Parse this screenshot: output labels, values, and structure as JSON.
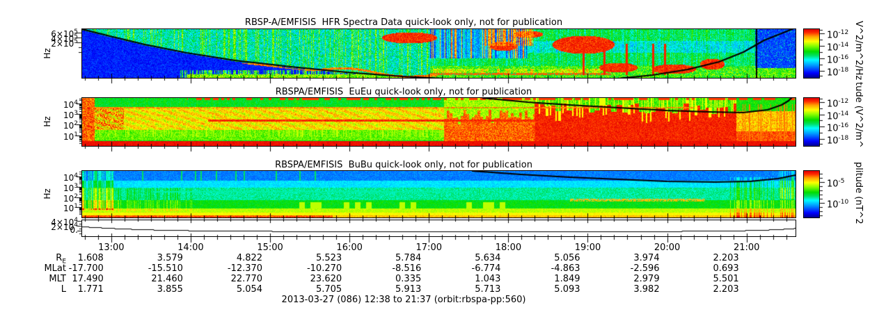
{
  "figure": {
    "bg": "#ffffff",
    "text_color": "#000000"
  },
  "chart_data": {
    "type": "heatmap",
    "subtype": "spectrogram-stack",
    "time_range": {
      "start": "12:38",
      "end": "21:37",
      "date": "2013-03-27",
      "doy": "086"
    },
    "x_ticks": {
      "major_labels": [
        "13:00",
        "14:00",
        "15:00",
        "16:00",
        "17:00",
        "18:00",
        "19:00",
        "20:00",
        "21:00"
      ],
      "major_fracs": [
        0.0408,
        0.1521,
        0.2635,
        0.3748,
        0.4861,
        0.5975,
        0.7088,
        0.8201,
        0.9314
      ],
      "minor_step_minutes": 10,
      "total_minutes": 539
    },
    "panels": [
      {
        "id": "hfr",
        "title": "RBSP-A/EMFISIS  HFR Spectra Data quick-look only, not for publication",
        "ylabel": "Hz",
        "ytick_labels": [
          "6×10^5",
          "4×10^5",
          "2×10^5"
        ],
        "ytick_rel": [
          5,
          12,
          19
        ],
        "overlay": "fce black curve, dips below panel mid-orbit",
        "colormap": "rainbow",
        "colorbar": {
          "unit": "V^2/m^2/Hz",
          "tick_labels": [
            "10^-12",
            "10^-14",
            "10^-16",
            "10^-18"
          ],
          "tick_fracs": [
            0.086,
            0.343,
            0.6,
            0.857
          ]
        }
      },
      {
        "id": "euEu",
        "title": "RBSPA/EMFISIS  EuEu quick-look only, not for publication",
        "ylabel": "Hz",
        "ytick_labels": [
          "10^4",
          "10^3",
          "10^2",
          "10^1"
        ],
        "ytick_rel": [
          8,
          23,
          38,
          54
        ],
        "overlay": "fce black curve near top, enters at ~55% width",
        "colormap": "rainbow",
        "colorbar": {
          "unit": "tude (V^2/m^",
          "tick_labels": [
            "10^-12",
            "10^-14",
            "10^-16",
            "10^-18"
          ],
          "tick_fracs": [
            0.086,
            0.343,
            0.6,
            0.857
          ]
        }
      },
      {
        "id": "buBu",
        "title": "RBSPA/EMFISIS  BuBu quick-look only, not for publication",
        "ylabel": "Hz",
        "ytick_labels": [
          "10^4",
          "10^3",
          "10^2",
          "10^1"
        ],
        "ytick_rel": [
          8,
          23,
          38,
          52
        ],
        "overlay": "fce black curve near top, enters at ~55% width",
        "colormap": "rainbow",
        "colorbar": {
          "unit": "plitude (nT^2",
          "tick_labels": [
            "10^-5",
            "10^-10"
          ],
          "tick_fracs": [
            0.24,
            0.69
          ]
        }
      }
    ],
    "aux_panel": {
      "type": "line",
      "ytick_labels": [
        "4×10^4",
        "2×10^4",
        "0."
      ],
      "ytick_rel": [
        1,
        8,
        15
      ],
      "series_points_frac": [
        [
          0,
          0.39
        ],
        [
          0.02,
          0.44
        ],
        [
          0.045,
          0.5
        ],
        [
          0.075,
          0.555
        ],
        [
          0.11,
          0.6
        ],
        [
          0.155,
          0.635
        ],
        [
          0.21,
          0.66
        ],
        [
          0.27,
          0.675
        ],
        [
          0.35,
          0.685
        ],
        [
          0.5,
          0.69
        ],
        [
          0.65,
          0.687
        ],
        [
          0.78,
          0.682
        ],
        [
          0.855,
          0.672
        ],
        [
          0.9,
          0.655
        ],
        [
          0.93,
          0.63
        ],
        [
          0.955,
          0.6
        ],
        [
          0.975,
          0.565
        ],
        [
          0.99,
          0.525
        ],
        [
          1,
          0.49
        ]
      ]
    },
    "ephemeris": {
      "row_labels": [
        {
          "main": "R",
          "sub": "E"
        },
        {
          "main": "MLat",
          "sub": ""
        },
        {
          "main": "MLT",
          "sub": ""
        },
        {
          "main": "L",
          "sub": ""
        }
      ],
      "rows": [
        [
          "1.608",
          "3.579",
          "4.822",
          "5.523",
          "5.784",
          "5.634",
          "5.056",
          "3.974",
          "2.203"
        ],
        [
          "-17.700",
          "-15.510",
          "-12.370",
          "-10.270",
          "-8.516",
          "-6.774",
          "-4.863",
          "-2.596",
          "0.693"
        ],
        [
          "17.490",
          "21.460",
          "22.770",
          "23.620",
          "0.335",
          "1.043",
          "1.849",
          "2.979",
          "5.501"
        ],
        [
          "1.771",
          "3.855",
          "5.054",
          "5.705",
          "5.913",
          "5.713",
          "5.093",
          "3.982",
          "2.203"
        ]
      ]
    },
    "footer": "2013-03-27 (086) 12:38 to 21:37 (orbit:rbspa-pp:560)"
  }
}
